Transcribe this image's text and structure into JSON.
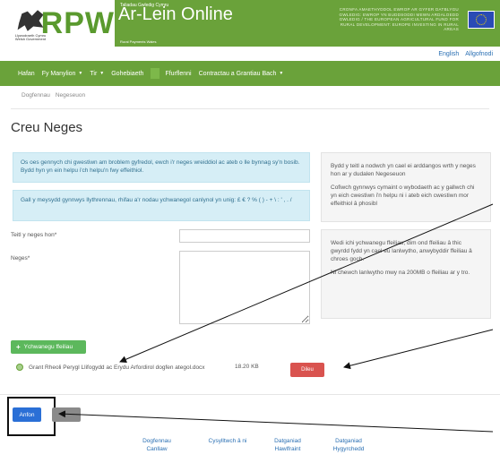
{
  "header": {
    "gov_label": "Llywodraeth Cymru Welsh Government",
    "logo_text": "RPW",
    "product_small": "Taliadau Gwledig Cymru",
    "product_name": "Ar-Lein Online",
    "product_sub": "Rural Payments Wales",
    "eu_text": "CRONFA AMAETHYDDOL EWROP AR GYFER DATBLYGU GWLEDIG: EWROP YN BUDDSODDI MEWN ARDALOEDD GWLEDIG / THE EUROPEAN AGRICULTURAL FUND FOR RURAL DEVELOPMENT: EUROPE INVESTING IN RURAL AREAS"
  },
  "languages": {
    "english": "English",
    "logout": "Allgofnodi"
  },
  "nav": {
    "items": [
      {
        "label": "Hafan",
        "has_caret": false
      },
      {
        "label": "Fy Manylion",
        "has_caret": true
      },
      {
        "label": "Tir",
        "has_caret": true
      },
      {
        "label": "Gohebiaeth",
        "has_caret": false
      },
      {
        "label": "Ffurflenni",
        "has_caret": false
      },
      {
        "label": "Contractau a Grantiau Bach",
        "has_caret": true
      }
    ]
  },
  "subtabs": {
    "documents": "Dogfennau",
    "messages": "Negeseuon"
  },
  "page_title": "Creu Neges",
  "alerts": {
    "help": "Os oes gennych chi gwestiwn am broblem gyfredol, ewch i'r neges wreiddiol ac ateb o lle bynnag sy'n bosib. Bydd hyn yn ein helpu i'ch helpu'n fwy effeithiol.",
    "chars": "Gall y meysydd gynnwys llythrennau, rhifau a'r nodau ychwanegol canlynol yn unig: £ € ? % ( ) - + \\ : ' , . /"
  },
  "right_panels": {
    "p1": [
      "Bydd y teitl a nodwch yn cael ei arddangos wrth y neges hon ar y dudalen Negeseuon",
      "Cofiwch gynnwys cymaint o wybodaeth ac y gallwch chi yn eich cwestiwn i'n helpu ni i ateb eich cwestiwn mor effeithiol â phosibl"
    ],
    "p2": [
      "Wedi ichi ychwanegu ffeiliau, dim ond ffeiliau â thic gwyrdd fydd yn cael eu lanlwytho, anwybyddir ffeiliau â chroes goch.",
      "Ni chewch lanlwytho mwy na 200MB o ffeiliau ar y tro."
    ]
  },
  "form": {
    "title_label": "Teitl y neges hon*",
    "message_label": "Neges*",
    "title_value": "",
    "message_value": ""
  },
  "attachments": {
    "add_label": "Ychwanegu ffeiliau",
    "file_name": "Grant Rheoli Perygl Llifogydd ac Erydu Arfordirol dogfen ategol.docx",
    "file_size": "18.20 KB",
    "delete_label": "Dileu"
  },
  "actions": {
    "send_label": "Anfon",
    "cancel_label": ""
  },
  "footer": [
    {
      "line1": "Dogfennau",
      "line2": "Canllaw"
    },
    {
      "line1": "Cysylltwch â ni",
      "line2": ""
    },
    {
      "line1": "Datganiad",
      "line2": "Hawlfraint"
    },
    {
      "line1": "Datganiad",
      "line2": "Hygyrchedd"
    }
  ],
  "colors": {
    "brand_green": "#6aa23a",
    "info_bg": "#d6eef6",
    "danger": "#d9534f",
    "primary": "#2a6fd6",
    "success": "#5cb85c",
    "link": "#2a6fb3"
  }
}
